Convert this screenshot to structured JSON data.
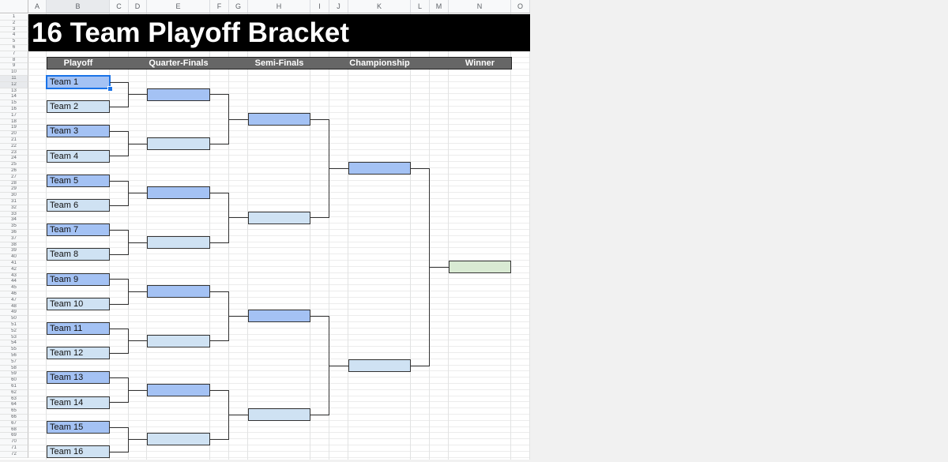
{
  "spreadsheet": {
    "columns": [
      "A",
      "B",
      "C",
      "D",
      "E",
      "F",
      "G",
      "H",
      "I",
      "J",
      "K",
      "L",
      "M",
      "N",
      "O"
    ],
    "selected_column": "B",
    "selected_cell": "B11",
    "row_count_visible": 72
  },
  "title": "16 Team Playoff Bracket",
  "headers": {
    "playoff": "Playoff",
    "quarter_finals": "Quarter-Finals",
    "semi_finals": "Semi-Finals",
    "championship": "Championship",
    "winner": "Winner"
  },
  "teams": [
    "Team 1",
    "Team 2",
    "Team 3",
    "Team 4",
    "Team 5",
    "Team 6",
    "Team 7",
    "Team 8",
    "Team 9",
    "Team 10",
    "Team 11",
    "Team 12",
    "Team 13",
    "Team 14",
    "Team 15",
    "Team 16"
  ],
  "quarter_finals": [
    "",
    "",
    "",
    "",
    "",
    "",
    "",
    ""
  ],
  "semi_finals": [
    "",
    "",
    "",
    ""
  ],
  "championship": [
    "",
    ""
  ],
  "winner": "",
  "colors": {
    "title_bg": "#000000",
    "header_bg": "#666666",
    "slot_dark": "#a4c2f4",
    "slot_light": "#cfe2f3",
    "winner_slot": "#d9ead3",
    "selection": "#1a73e8"
  }
}
